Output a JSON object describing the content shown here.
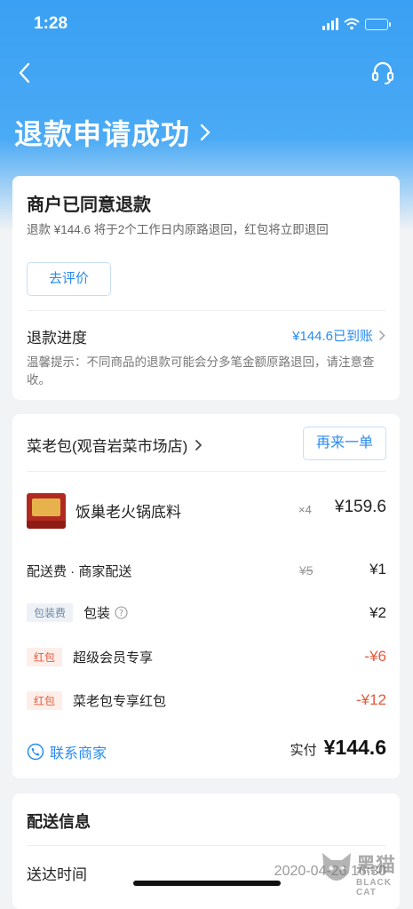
{
  "status_bar": {
    "time": "1:28"
  },
  "header": {
    "title": "退款申请成功"
  },
  "refund": {
    "heading": "商户已同意退款",
    "subtitle": "退款 ¥144.6 将于2个工作日内原路退回，红包将立即退回",
    "rate_button": "去评价",
    "progress_label": "退款进度",
    "progress_value": "¥144.6已到账",
    "tip": "温馨提示：不同商品的退款可能会分多笔金额原路退回，请注意查收。"
  },
  "order": {
    "shop_name": "菜老包(观音岩菜市场店)",
    "reorder_button": "再来一单",
    "item": {
      "name": "饭巢老火锅底料",
      "qty": "×4",
      "price": "¥159.6"
    },
    "delivery": {
      "label": "配送费 · 商家配送",
      "original": "¥5",
      "price": "¥1"
    },
    "packing": {
      "tag": "包装费",
      "label": "包装",
      "price": "¥2"
    },
    "coupons": [
      {
        "tag": "红包",
        "label": "超级会员专享",
        "amount": "-¥6"
      },
      {
        "tag": "红包",
        "label": "菜老包专享红包",
        "amount": "-¥12"
      }
    ],
    "contact": "联系商家",
    "paid_label": "实付",
    "paid_value": "¥144.6"
  },
  "delivery_info": {
    "heading": "配送信息",
    "time_label": "送达时间",
    "time_value": "2020-04-26 16:30"
  },
  "watermark": {
    "line1": "黑猫",
    "line2": "BLACK CAT"
  },
  "colors": {
    "accent": "#2a8bf2",
    "header_blue": "#3aa0f3",
    "discount_red": "#e4593a"
  }
}
